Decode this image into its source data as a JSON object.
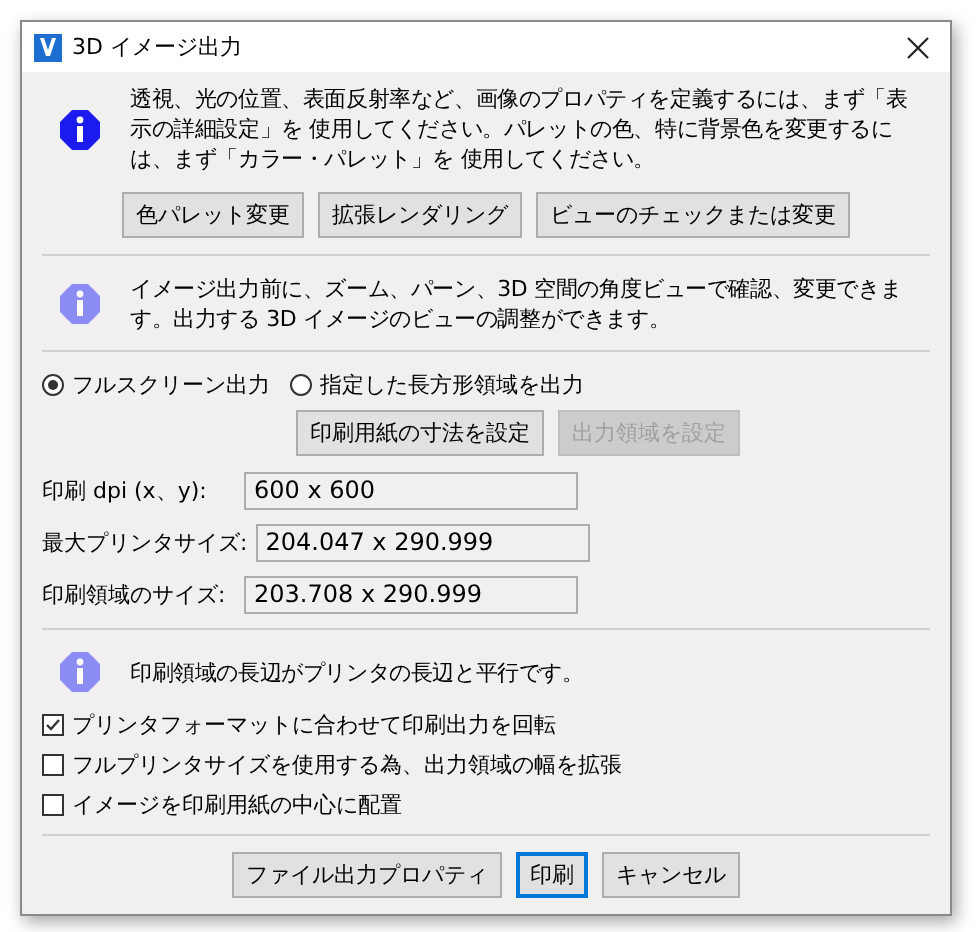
{
  "window": {
    "title": "3D イメージ出力"
  },
  "info_top": {
    "kind": "primary",
    "text": "透視、光の位置、表面反射率など、画像のプロパティを定義するには、まず「表示の詳細設定」を 使用してください。パレットの色、特に背景色を変更するには、まず「カラー・パレット」を 使用してください。",
    "buttons": [
      {
        "label": "色パレット変更"
      },
      {
        "label": "拡張レンダリング"
      },
      {
        "label": "ビューのチェックまたは変更"
      }
    ]
  },
  "info_view": {
    "kind": "secondary",
    "text": "イメージ出力前に、ズーム、パーン、3D 空間の角度ビューで確認、変更できます。出力する 3D イメージのビューの調整ができます。"
  },
  "output_mode": {
    "options": [
      {
        "label": "フルスクリーン出力",
        "selected": true
      },
      {
        "label": "指定した長方形領域を出力",
        "selected": false
      }
    ],
    "buttons": [
      {
        "label": "印刷用紙の寸法を設定",
        "disabled": false
      },
      {
        "label": "出力領域を設定",
        "disabled": true
      }
    ]
  },
  "fields": [
    {
      "label": "印刷 dpi (x、y):",
      "value": "600 x 600"
    },
    {
      "label": "最大プリンタサイズ:",
      "value": "204.047 x 290.999"
    },
    {
      "label": "印刷領域のサイズ:",
      "value": "203.708 x 290.999"
    }
  ],
  "orientation_note": {
    "kind": "secondary",
    "text": "印刷領域の長辺がプリンタの長辺と平行です。"
  },
  "checkboxes": [
    {
      "label": "プリンタフォーマットに合わせて印刷出力を回転",
      "checked": true
    },
    {
      "label": "フルプリンタサイズを使用する為、出力領域の幅を拡張",
      "checked": false
    },
    {
      "label": "イメージを印刷用紙の中心に配置",
      "checked": false
    }
  ],
  "footer_buttons": [
    {
      "label": "ファイル出力プロパティ",
      "default": false
    },
    {
      "label": "印刷",
      "default": true
    },
    {
      "label": "キャンセル",
      "default": false
    }
  ]
}
